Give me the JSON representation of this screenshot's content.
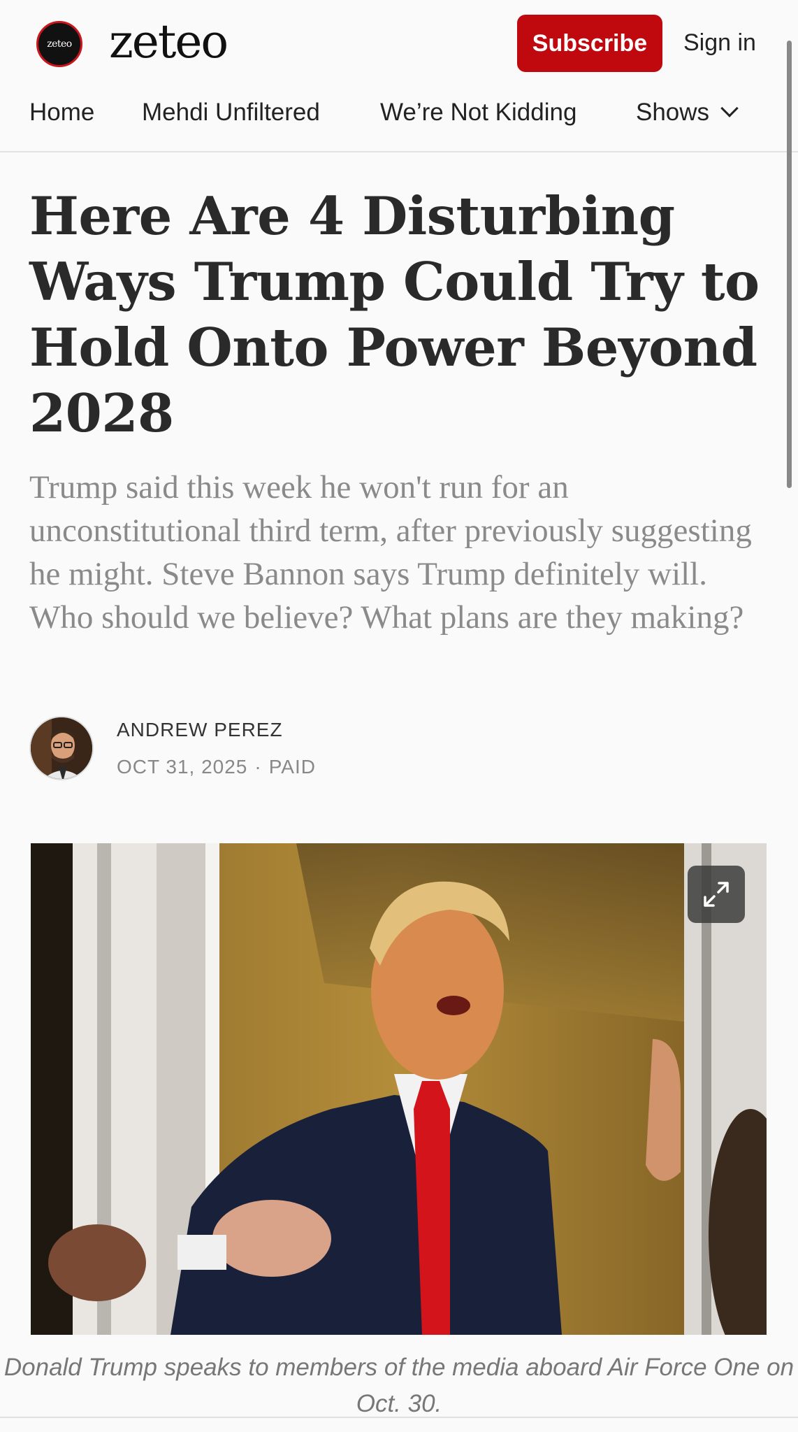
{
  "header": {
    "logo_badge_text": "zeteo",
    "wordmark": "zeteo",
    "subscribe_label": "Subscribe",
    "signin_label": "Sign in",
    "brand_color": "#c0090e"
  },
  "nav": {
    "items": [
      {
        "label": "Home"
      },
      {
        "label": "Mehdi Unfiltered"
      },
      {
        "label": "We’re Not Kidding"
      },
      {
        "label": "Shows"
      }
    ],
    "shows_icon": "chevron-down-icon"
  },
  "article": {
    "title": "Here Are 4 Disturbing Ways Trump Could Try to Hold Onto Power Beyond 2028",
    "subtitle": "Trump said this week he won't run for an unconstitutional third term, after previously suggesting he might. Steve Bannon says Trump definitely will. Who should we believe? What plans are they making?",
    "author": "ANDREW PEREZ",
    "date": "OCT 31, 2025",
    "separator": "·",
    "access": "PAID",
    "image_caption": "Donald Trump speaks to members of the media aboard Air Force One on Oct. 30.",
    "expand_icon": "expand-icon"
  }
}
